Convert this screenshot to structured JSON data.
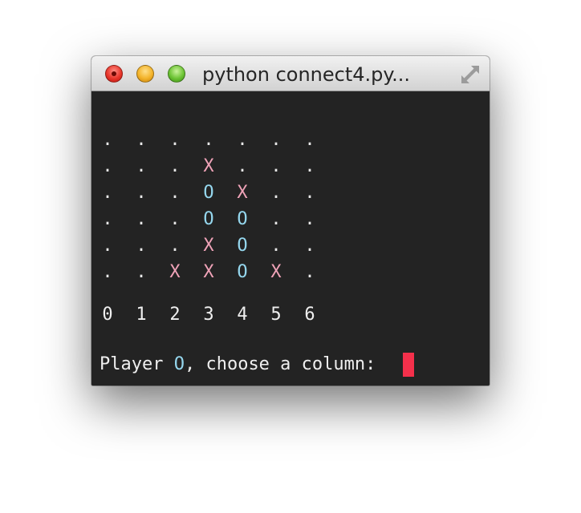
{
  "window": {
    "title": "python connect4.py..."
  },
  "board": {
    "rows": [
      [
        ".",
        ".",
        ".",
        ".",
        ".",
        ".",
        "."
      ],
      [
        ".",
        ".",
        ".",
        "X",
        ".",
        ".",
        "."
      ],
      [
        ".",
        ".",
        ".",
        "O",
        "X",
        ".",
        "."
      ],
      [
        ".",
        ".",
        ".",
        "O",
        "O",
        ".",
        "."
      ],
      [
        ".",
        ".",
        ".",
        "X",
        "O",
        ".",
        "."
      ],
      [
        ".",
        ".",
        "X",
        "X",
        "O",
        "X",
        "."
      ]
    ],
    "column_labels": [
      "0",
      "1",
      "2",
      "3",
      "4",
      "5",
      "6"
    ]
  },
  "prompt": {
    "prefix": "Player ",
    "player": "O",
    "suffix": ", choose a column: "
  },
  "colors": {
    "background": "#232323",
    "x_piece": "#f0a3b8",
    "o_piece": "#95d7ee",
    "cursor": "#f4304b"
  },
  "icons": {
    "close": "close-button",
    "minimize": "minimize-button",
    "zoom": "zoom-button",
    "fullscreen": "fullscreen-icon"
  }
}
